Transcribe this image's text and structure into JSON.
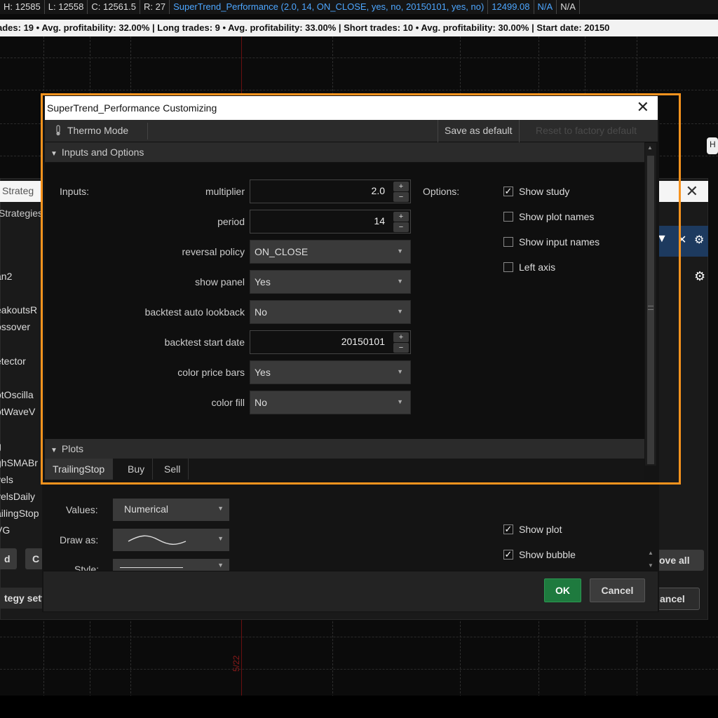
{
  "chart_header": {
    "cells": [
      "H: 12585",
      "L: 12558",
      "C: 12561.5",
      "R: 27"
    ],
    "study": "SuperTrend_Performance (2.0, 14, ON_CLOSE, yes, no, 20150101, yes, no)",
    "price": "12499.08",
    "na1": "N/A",
    "na2": "N/A"
  },
  "summary_text": "ades: 19 • Avg. profitability: 32.00% | Long trades: 9 • Avg. profitability: 33.00% | Short trades: 10 • Avg. profitability: 30.00% | Start date: 20150",
  "chart_date_label": "5/22",
  "background_window": {
    "title_fragment": "l Strateg",
    "tab_fragment": "Strategies",
    "list": [
      "an2",
      "eakoutsR",
      "ossover",
      "etector",
      "otOscilla",
      "otWaveV",
      "g",
      "ghSMABr",
      "vels",
      "velsDaily",
      "ailingStop",
      "VG"
    ],
    "button_left1": "d",
    "button_left2": "C",
    "button_bottom_left": "tegy sett",
    "button_remove_all": "ove all",
    "button_cancel": "ancel",
    "side_tip": "H"
  },
  "dialog": {
    "title": "SuperTrend_Performance Customizing",
    "toolbar": {
      "thermo_mode": "Thermo Mode",
      "save_default": "Save as default",
      "reset_factory": "Reset to factory default"
    },
    "section_inputs": "Inputs and Options",
    "inputs_label": "Inputs:",
    "options_label": "Options:",
    "inputs": {
      "multiplier": {
        "label": "multiplier",
        "value": "2.0"
      },
      "period": {
        "label": "period",
        "value": "14"
      },
      "reversal_policy": {
        "label": "reversal policy",
        "value": "ON_CLOSE"
      },
      "show_panel": {
        "label": "show panel",
        "value": "Yes"
      },
      "backtest_auto_lookback": {
        "label": "backtest auto lookback",
        "value": "No"
      },
      "backtest_start_date": {
        "label": "backtest start date",
        "value": "20150101"
      },
      "color_price_bars": {
        "label": "color price bars",
        "value": "Yes"
      },
      "color_fill": {
        "label": "color fill",
        "value": "No"
      }
    },
    "options": [
      {
        "label": "Show study",
        "checked": true
      },
      {
        "label": "Show plot names",
        "checked": false
      },
      {
        "label": "Show input names",
        "checked": false
      },
      {
        "label": "Left axis",
        "checked": false
      }
    ],
    "section_plots": "Plots",
    "plot_tabs": [
      "TrailingStop",
      "Buy",
      "Sell"
    ],
    "plot_settings": {
      "values_label": "Values:",
      "values_value": "Numerical",
      "draw_as_label": "Draw as:",
      "style_label": "Style:",
      "show_plot": "Show plot",
      "show_bubble": "Show bubble"
    },
    "ok": "OK",
    "cancel": "Cancel"
  },
  "colors": {
    "highlight": "#f7931e",
    "ok_green": "#1e7a3e",
    "header_blue": "#4da6ff"
  }
}
